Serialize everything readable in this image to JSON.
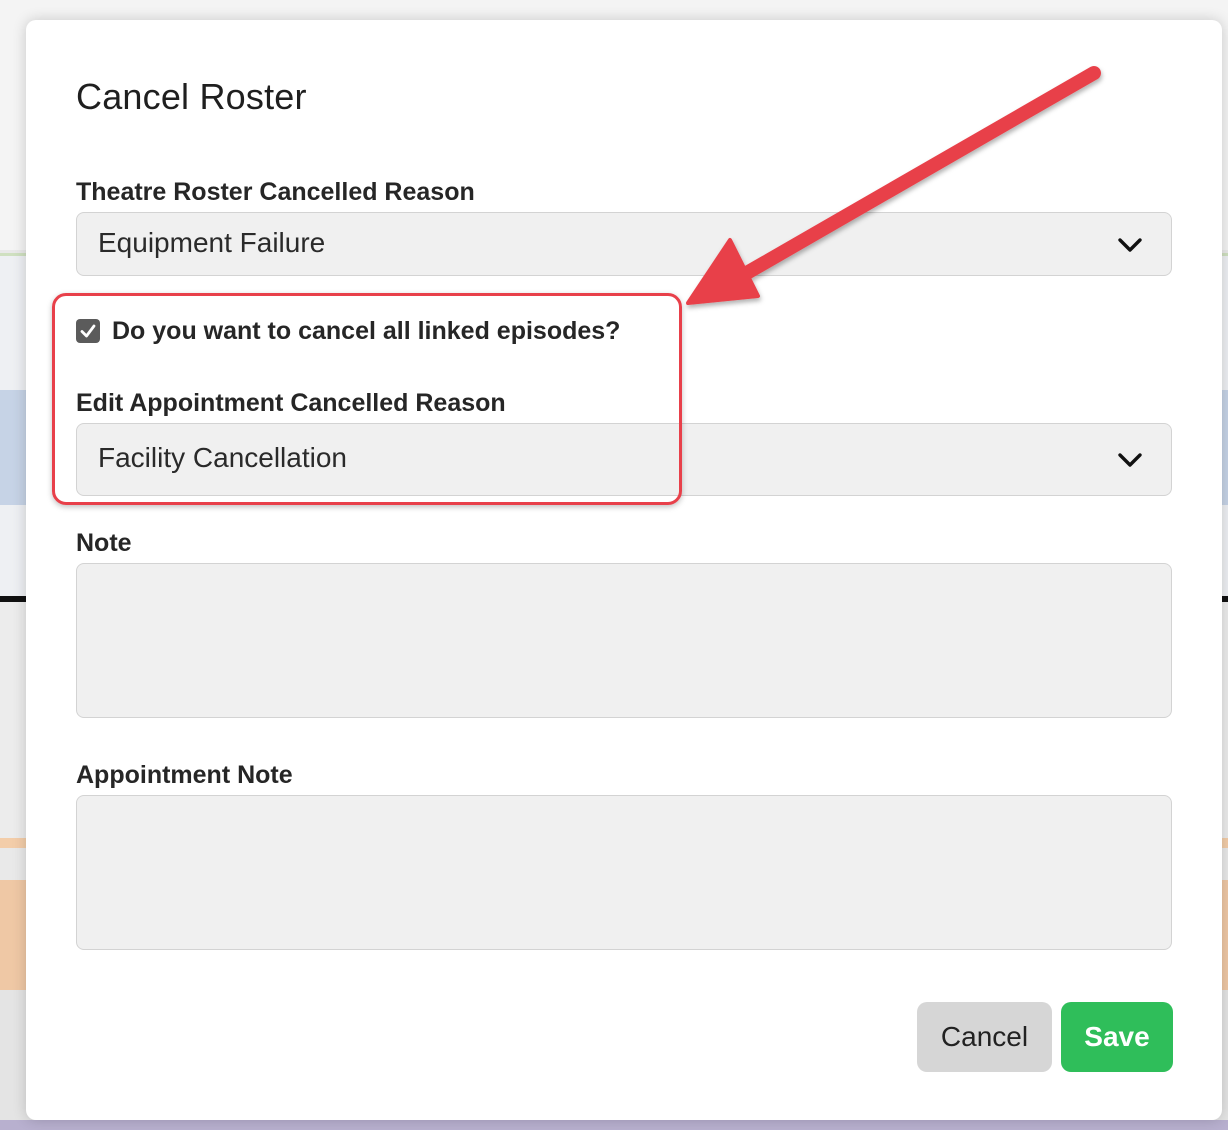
{
  "modal": {
    "title": "Cancel Roster",
    "theatre_reason": {
      "label": "Theatre Roster Cancelled Reason",
      "value": "Equipment Failure"
    },
    "cancel_linked": {
      "label": "Do you want to cancel all linked episodes?",
      "checked": true
    },
    "appointment_reason": {
      "label": "Edit Appointment Cancelled Reason",
      "value": "Facility Cancellation"
    },
    "note": {
      "label": "Note",
      "value": ""
    },
    "appointment_note": {
      "label": "Appointment Note",
      "value": ""
    },
    "buttons": {
      "cancel": "Cancel",
      "save": "Save"
    }
  },
  "annotation": {
    "color": "#e8404a",
    "arrow_icon": "annotation-arrow-icon"
  },
  "colors": {
    "save_button": "#2fbe5a",
    "cancel_button": "#d6d6d6",
    "field_background": "#f0f0f0"
  }
}
